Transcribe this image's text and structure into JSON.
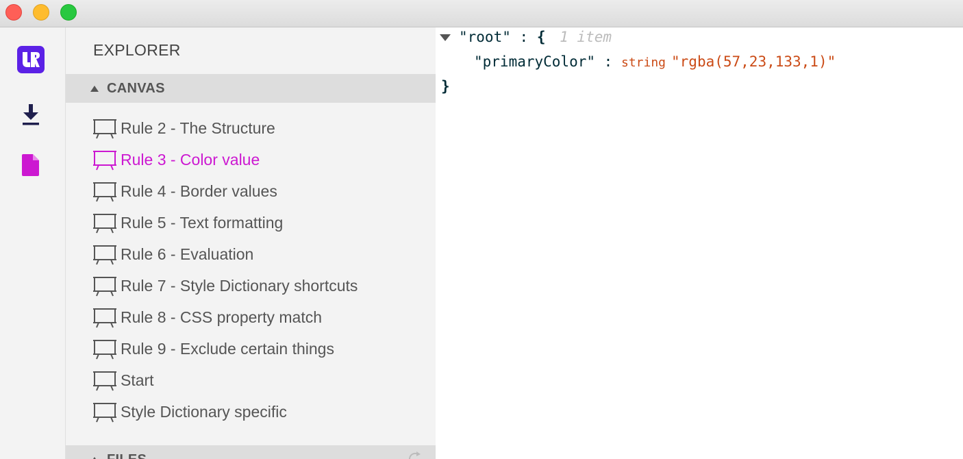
{
  "activity_bar": {
    "icons": [
      "logo-icon",
      "download-icon",
      "file-icon"
    ],
    "colors": {
      "logo": "#5b21e6",
      "download": "#1f1f4d",
      "file": "#cc18d1"
    }
  },
  "sidebar": {
    "title": "EXPLORER",
    "canvas_section": {
      "label": "CANVAS"
    },
    "canvas_items": [
      {
        "label": "Rule 2 - The Structure",
        "active": false
      },
      {
        "label": "Rule 3 - Color value",
        "active": true
      },
      {
        "label": "Rule 4 - Border values",
        "active": false
      },
      {
        "label": "Rule 5 - Text formatting",
        "active": false
      },
      {
        "label": "Rule 6 - Evaluation",
        "active": false
      },
      {
        "label": "Rule 7 - Style Dictionary shortcuts",
        "active": false
      },
      {
        "label": "Rule 8 - CSS property match",
        "active": false
      },
      {
        "label": "Rule 9 - Exclude certain things",
        "active": false
      },
      {
        "label": "Start",
        "active": false
      },
      {
        "label": "Style Dictionary specific",
        "active": false
      }
    ],
    "files_section": {
      "label": "FILES"
    },
    "active_color": "#cc18d1"
  },
  "editor": {
    "root_key": "\"root\"",
    "colon": ":",
    "open_brace": "{",
    "item_count": "1 item",
    "prop_key": "\"primaryColor\"",
    "prop_type": "string",
    "prop_value": "\"rgba(57,23,133,1)\"",
    "close_brace": "}"
  }
}
